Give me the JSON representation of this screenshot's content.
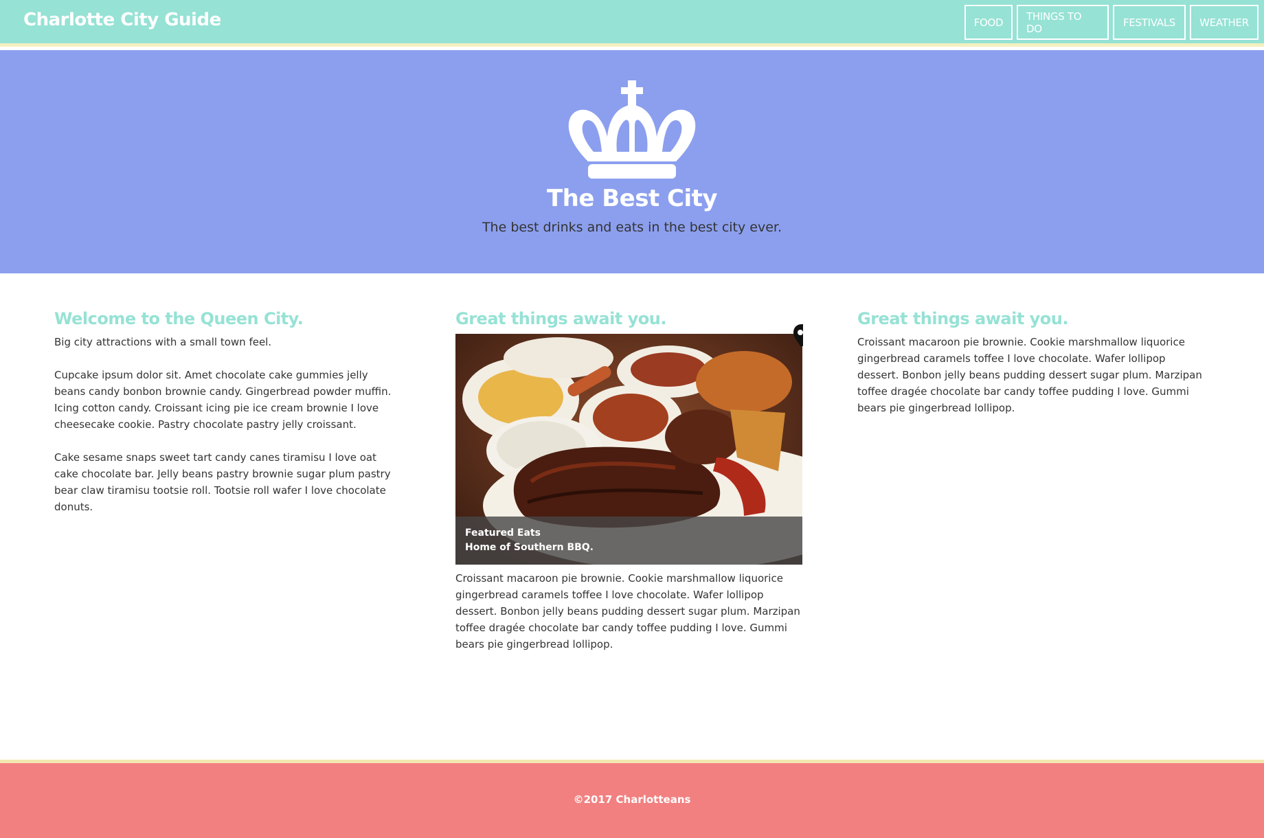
{
  "header": {
    "brand": "Charlotte City Guide",
    "nav": [
      "FOOD",
      "THINGS TO DO",
      "FESTIVALS",
      "WEATHER"
    ]
  },
  "hero": {
    "icon": "crown-icon",
    "title": "The Best City",
    "subtitle": "The best drinks and eats in the best city ever."
  },
  "columns": [
    {
      "heading": "Welcome to the Queen City.",
      "paragraphs": [
        "Big city attractions with a small town feel.",
        "Cupcake ipsum dolor sit. Amet chocolate cake gummies jelly beans candy bonbon brownie candy. Gingerbread powder muffin. Icing cotton candy. Croissant icing pie ice cream brownie I love cheesecake cookie. Pastry chocolate pastry jelly croissant.",
        "Cake sesame snaps sweet tart candy canes tiramisu I love oat cake chocolate bar. Jelly beans pastry brownie sugar plum pastry bear claw tiramisu tootsie roll. Tootsie roll wafer I love chocolate donuts."
      ]
    },
    {
      "heading": "Great things await you.",
      "feature": {
        "caption_title": "Featured Eats",
        "caption_text": "Home of Southern BBQ."
      },
      "paragraphs": [
        "Croissant macaroon pie brownie. Cookie marshmallow liquorice gingerbread caramels toffee I love chocolate. Wafer lollipop dessert. Bonbon jelly beans pudding dessert sugar plum. Marzipan toffee dragée chocolate bar candy toffee pudding I love. Gummi bears pie gingerbread lollipop."
      ]
    },
    {
      "heading": "Great things await you.",
      "paragraphs": [
        "Croissant macaroon pie brownie. Cookie marshmallow liquorice gingerbread caramels toffee I love chocolate. Wafer lollipop dessert. Bonbon jelly beans pudding dessert sugar plum. Marzipan toffee dragée chocolate bar candy toffee pudding I love. Gummi bears pie gingerbread lollipop."
      ]
    }
  ],
  "footer": {
    "text": "©2017 Charlotteans"
  },
  "colors": {
    "navbar": "#96e2d5",
    "hero": "#8c9fee",
    "heading": "#96e2d5",
    "footer": "#f28080"
  }
}
